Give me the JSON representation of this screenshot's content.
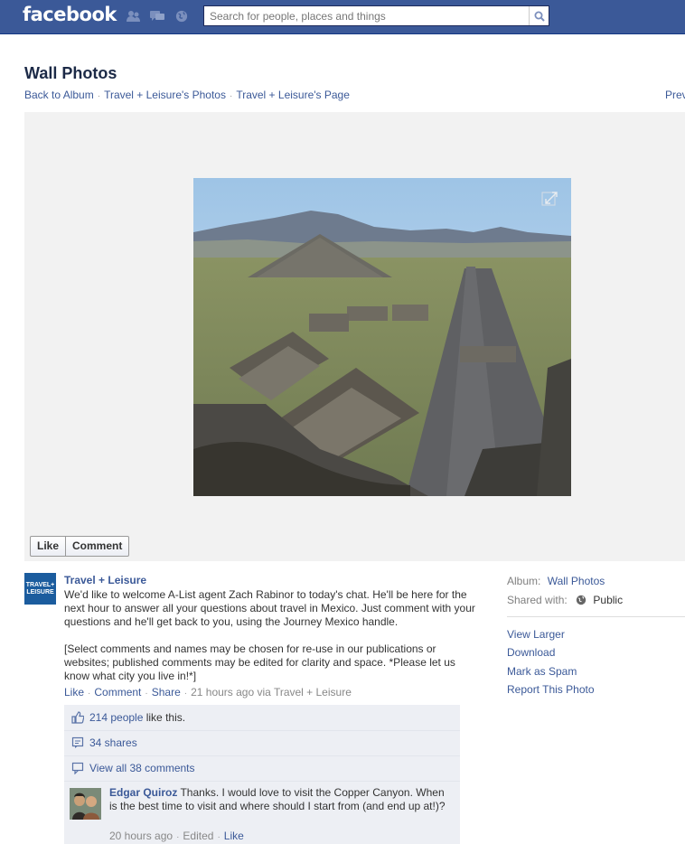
{
  "topbar": {
    "logo": "facebook",
    "search": {
      "placeholder": "Search for people, places and things",
      "value": ""
    }
  },
  "header": {
    "title": "Wall Photos",
    "breadcrumbs": [
      "Back to Album",
      "Travel + Leisure's Photos",
      "Travel + Leisure's Page"
    ],
    "prev_label": "Prev"
  },
  "photo": {
    "description": "aerial view of pyramids"
  },
  "actions": {
    "like": "Like",
    "comment": "Comment"
  },
  "post": {
    "avatar_text": [
      "TRAVEL+",
      "LEISURE"
    ],
    "author": "Travel + Leisure",
    "paragraph1": "We'd like to welcome A-List agent Zach Rabinor to today's chat. He'll be here for the next hour to answer all your questions about travel in Mexico. Just comment with your questions and he'll get back to you, using the Journey Mexico handle.",
    "paragraph2": "[Select comments and names may be chosen for re-use in our publications or websites; published comments may be edited for clarity and space. *Please let us know what city you live in!*]",
    "meta": {
      "like": "Like",
      "comment": "Comment",
      "share": "Share",
      "time": "21 hours ago via Travel + Leisure"
    }
  },
  "ufi": {
    "likes_link": "214 people",
    "likes_suffix": " like this.",
    "shares": "34 shares",
    "view_all": "View all 38 comments",
    "comment": {
      "author": "Edgar Quiroz",
      "text": "Thanks. I would love to visit the Copper Canyon. When is the best time to visit and where should I start from (and end up at!)?",
      "time": "20 hours ago",
      "edited": "Edited",
      "like": "Like"
    }
  },
  "sidebar": {
    "album_label": "Album:",
    "album_value": "Wall Photos",
    "shared_label": "Shared with:",
    "shared_value": "Public",
    "links": [
      "View Larger",
      "Download",
      "Mark as Spam",
      "Report This Photo"
    ]
  },
  "colors": {
    "brand": "#3b5998",
    "link": "#3b5998",
    "ufi_bg": "#edeff4",
    "stage_bg": "#f2f2f2"
  }
}
